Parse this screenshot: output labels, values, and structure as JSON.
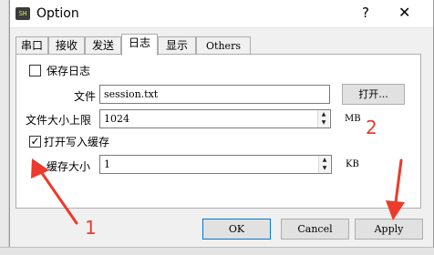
{
  "window": {
    "title": "Option",
    "app_icon_text": "SH",
    "help_glyph": "?",
    "close_glyph": "✕"
  },
  "tabs": [
    {
      "label": "串口"
    },
    {
      "label": "接收"
    },
    {
      "label": "发送"
    },
    {
      "label": "日志",
      "active": true
    },
    {
      "label": "显示"
    },
    {
      "label": "Others"
    }
  ],
  "log": {
    "save_checkbox": {
      "label": "保存日志",
      "checked": false,
      "mark": ""
    },
    "file_label": "文件",
    "file_value": "session.txt",
    "open_button": "打开...",
    "max_size_label": "文件大小上限",
    "max_size_value": "1024",
    "max_size_unit": "MB",
    "buffered_checkbox": {
      "label": "打开写入缓存",
      "checked": true,
      "mark": "✓"
    },
    "buffer_size_label": "缓存大小",
    "buffer_size_value": "1",
    "buffer_size_unit": "KB"
  },
  "buttons": {
    "ok": "OK",
    "cancel": "Cancel",
    "apply": "Apply"
  },
  "annotations": {
    "left_number": "1",
    "right_number": "2",
    "color": "#ec3a2c"
  },
  "colors": {
    "focus_border": "#0078d7"
  }
}
